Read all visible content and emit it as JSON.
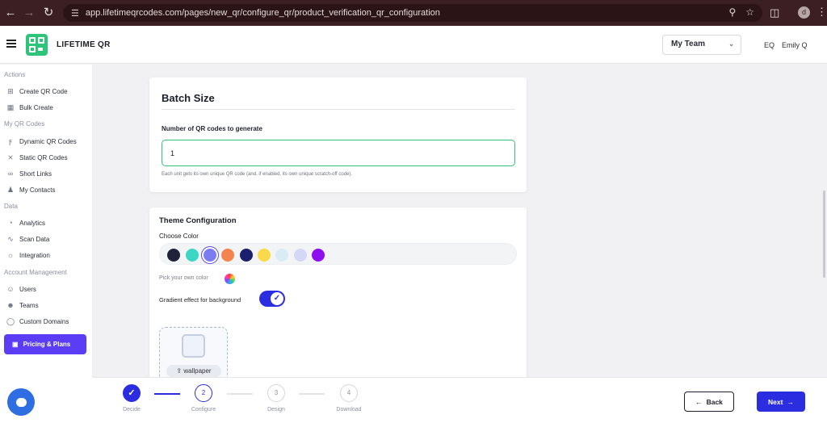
{
  "browser": {
    "url": "app.lifetimeqrcodes.com/pages/new_qr/configure_qr/product_verification_qr_configuration",
    "profile_initial": "d"
  },
  "header": {
    "brand": "LIFETIME QR",
    "team_select": "My Team",
    "user_initials": "EQ",
    "user_name": "Emily Q"
  },
  "sidebar": {
    "sections": [
      {
        "title": "Actions",
        "items": [
          {
            "label": "Create QR Code",
            "icon": "plus-square-icon"
          },
          {
            "label": "Bulk Create",
            "icon": "grid-icon"
          }
        ]
      },
      {
        "title": "My QR Codes",
        "items": [
          {
            "label": "Dynamic QR Codes",
            "icon": "bolt-icon"
          },
          {
            "label": "Static QR Codes",
            "icon": "bolt-off-icon"
          },
          {
            "label": "Short Links",
            "icon": "link-icon"
          },
          {
            "label": "My Contacts",
            "icon": "contacts-icon"
          }
        ]
      },
      {
        "title": "Data",
        "items": [
          {
            "label": "Analytics",
            "icon": "pie-chart-icon"
          },
          {
            "label": "Scan Data",
            "icon": "activity-icon"
          },
          {
            "label": "Integration",
            "icon": "bulb-icon"
          }
        ]
      },
      {
        "title": "Account Management",
        "items": [
          {
            "label": "Users",
            "icon": "user-plus-icon"
          },
          {
            "label": "Teams",
            "icon": "users-icon"
          },
          {
            "label": "Custom Domains",
            "icon": "shield-icon"
          }
        ]
      }
    ],
    "pricing_label": "Pricing & Plans"
  },
  "batch": {
    "title": "Batch Size",
    "field_label": "Number of QR codes to generate",
    "value": "1",
    "help": "Each unit gets its own unique QR code (and, if enabled, its own unique scratch-off code)."
  },
  "theme": {
    "title": "Theme Configuration",
    "choose_label": "Choose Color",
    "swatches": [
      "#1f2238",
      "#3dd6c3",
      "#7b7cf3",
      "#f4844e",
      "#1a1f6e",
      "#fbd94a",
      "#d9ecf6",
      "#d4d8f6",
      "#8f0ef0"
    ],
    "selected_index": 2,
    "pick_own_label": "Pick your own color",
    "gradient_label": "Gradient effect for background",
    "gradient_enabled": true,
    "wallpaper_label": "wallpaper"
  },
  "stepper": {
    "steps": [
      {
        "num": "1",
        "label": "Decide",
        "state": "done"
      },
      {
        "num": "2",
        "label": "Configure",
        "state": "current"
      },
      {
        "num": "3",
        "label": "Design",
        "state": "upcoming"
      },
      {
        "num": "4",
        "label": "Download",
        "state": "upcoming"
      }
    ],
    "back_label": "Back",
    "next_label": "Next"
  }
}
